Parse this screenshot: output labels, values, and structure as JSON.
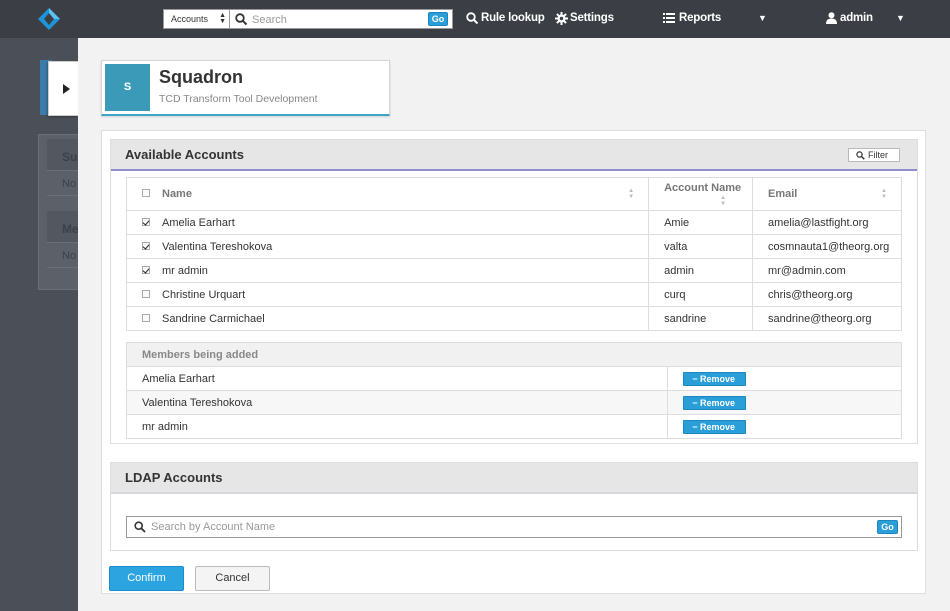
{
  "topbar": {
    "account_select": "Accounts",
    "search_placeholder": "Search",
    "go_label": "Go",
    "rule_lookup": "Rule lookup",
    "settings": "Settings",
    "reports": "Reports",
    "user": "admin"
  },
  "group": {
    "initial": "S",
    "name": "Squadron",
    "description": "TCD Transform Tool Development"
  },
  "available": {
    "title": "Available Accounts",
    "filter_label": "Filter",
    "columns": {
      "name": "Name",
      "account_name": "Account Name",
      "email": "Email"
    },
    "rows": [
      {
        "name": "Amelia Earhart",
        "account": "Amie",
        "email": "amelia@lastfight.org",
        "checked": true
      },
      {
        "name": "Valentina Tereshokova",
        "account": "valta",
        "email": "cosmnauta1@theorg.org",
        "checked": true
      },
      {
        "name": "mr admin",
        "account": "admin",
        "email": "mr@admin.com",
        "checked": true
      },
      {
        "name": "Christine Urquart",
        "account": "curq",
        "email": "chris@theorg.org",
        "checked": false
      },
      {
        "name": "Sandrine Carmichael",
        "account": "sandrine",
        "email": "sandrine@theorg.org",
        "checked": false
      }
    ]
  },
  "members": {
    "header": "Members being added",
    "remove_label": "Remove",
    "rows": [
      {
        "name": "Amelia Earhart"
      },
      {
        "name": "Valentina Tereshokova"
      },
      {
        "name": "mr admin"
      }
    ]
  },
  "ldap": {
    "title": "LDAP Accounts",
    "search_placeholder": "Search by Account Name",
    "go_label": "Go"
  },
  "actions": {
    "confirm": "Confirm",
    "cancel": "Cancel"
  },
  "background": {
    "card_header_1": "Su",
    "card_row_1": "No",
    "card_header_2": "Me",
    "card_row_2": "No"
  },
  "colors": {
    "accent": "#2ba4e0",
    "topbar": "#3b3f45",
    "avatar": "#3b9ab8"
  },
  "icons": {
    "logo": "diamond-logo-icon",
    "search": "search-icon",
    "settings": "gear-icon",
    "reports": "list-icon",
    "user": "user-icon"
  }
}
